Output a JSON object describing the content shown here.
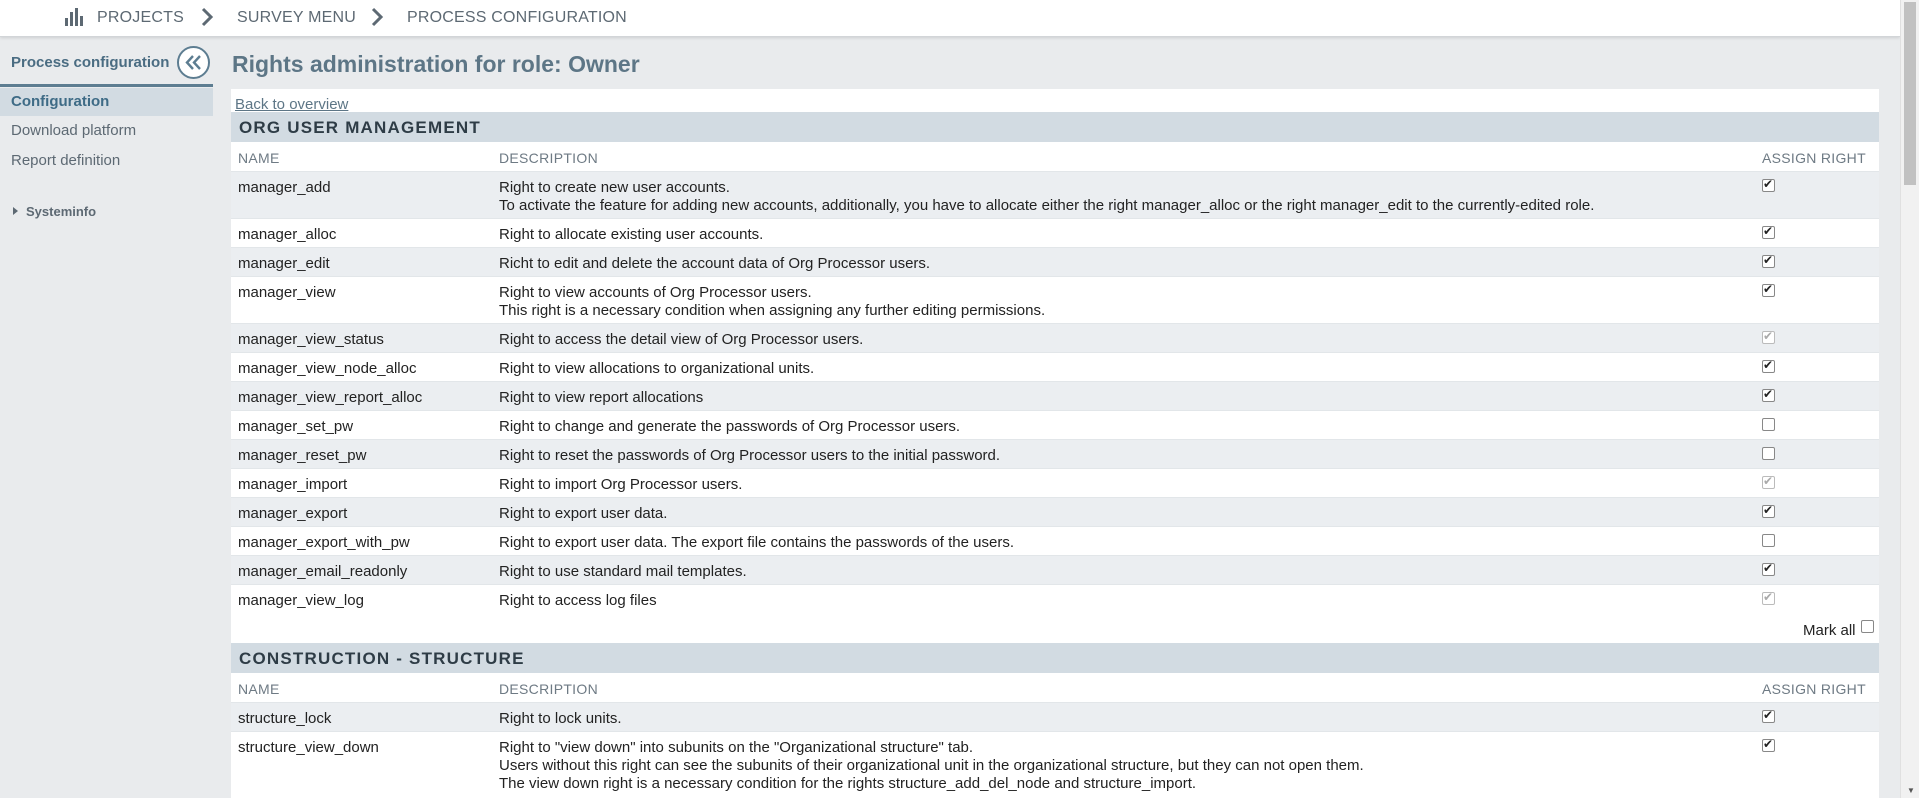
{
  "nav": {
    "crumbs": [
      "PROJECTS",
      "SURVEY MENU",
      "PROCESS CONFIGURATION"
    ]
  },
  "sidebar": {
    "title": "Process configuration",
    "items": [
      {
        "label": "Configuration",
        "active": true
      },
      {
        "label": "Download platform",
        "active": false
      },
      {
        "label": "Report definition",
        "active": false
      }
    ],
    "systeminfo": "Systeminfo"
  },
  "main": {
    "title": "Rights administration for role: Owner",
    "back_link": "Back to overview",
    "col_name": "NAME",
    "col_description": "DESCRIPTION",
    "col_assign": "ASSIGN RIGHT",
    "mark_all": "Mark all",
    "sections": [
      {
        "title": "ORG USER MANAGEMENT",
        "rows": [
          {
            "name": "manager_add",
            "desc": "Right to create new user accounts.\nTo activate the feature for adding new accounts, additionally, you have to allocate either the right manager_alloc or the right manager_edit to the currently-edited role.",
            "checked": true,
            "disabled": false
          },
          {
            "name": "manager_alloc",
            "desc": "Right to allocate existing user accounts.",
            "checked": true,
            "disabled": false
          },
          {
            "name": "manager_edit",
            "desc": "Richt to edit and delete the account data of Org Processor users.",
            "checked": true,
            "disabled": false
          },
          {
            "name": "manager_view",
            "desc": "Right to view accounts of Org Processor users.\nThis right is a necessary condition when assigning any further editing permissions.",
            "checked": true,
            "disabled": false
          },
          {
            "name": "manager_view_status",
            "desc": "Right to access the detail view of Org Processor users.",
            "checked": true,
            "disabled": true
          },
          {
            "name": "manager_view_node_alloc",
            "desc": "Right to view allocations to organizational units.",
            "checked": true,
            "disabled": false
          },
          {
            "name": "manager_view_report_alloc",
            "desc": "Right to view report allocations",
            "checked": true,
            "disabled": false
          },
          {
            "name": "manager_set_pw",
            "desc": "Right to change and generate the passwords of Org Processor users.",
            "checked": false,
            "disabled": false
          },
          {
            "name": "manager_reset_pw",
            "desc": "Right to reset the passwords of Org Processor users to the initial password.",
            "checked": false,
            "disabled": false
          },
          {
            "name": "manager_import",
            "desc": "Right to import Org Processor users.",
            "checked": true,
            "disabled": true
          },
          {
            "name": "manager_export",
            "desc": "Right to export user data.",
            "checked": true,
            "disabled": false
          },
          {
            "name": "manager_export_with_pw",
            "desc": "Right to export user data. The export file contains the passwords of the users.",
            "checked": false,
            "disabled": false
          },
          {
            "name": "manager_email_readonly",
            "desc": "Right to use standard mail templates.",
            "checked": true,
            "disabled": false
          },
          {
            "name": "manager_view_log",
            "desc": "Right to access log files",
            "checked": true,
            "disabled": true
          }
        ]
      },
      {
        "title": "CONSTRUCTION - STRUCTURE",
        "rows": [
          {
            "name": "structure_lock",
            "desc": "Right to lock units.",
            "checked": true,
            "disabled": false
          },
          {
            "name": "structure_view_down",
            "desc": "Right to \"view down\" into subunits on the \"Organizational structure\" tab.\nUsers without this right can see the subunits of their organizational unit in the organizational structure, but they can not open them.\nThe view down right is a necessary condition for the rights structure_add_del_node and structure_import.",
            "checked": true,
            "disabled": false
          }
        ]
      }
    ]
  },
  "colors": {
    "accent": "#5d7d91",
    "section_bg": "#d2dbe2",
    "alt_row": "#ebeef1",
    "page_bg": "#e9ebed"
  }
}
